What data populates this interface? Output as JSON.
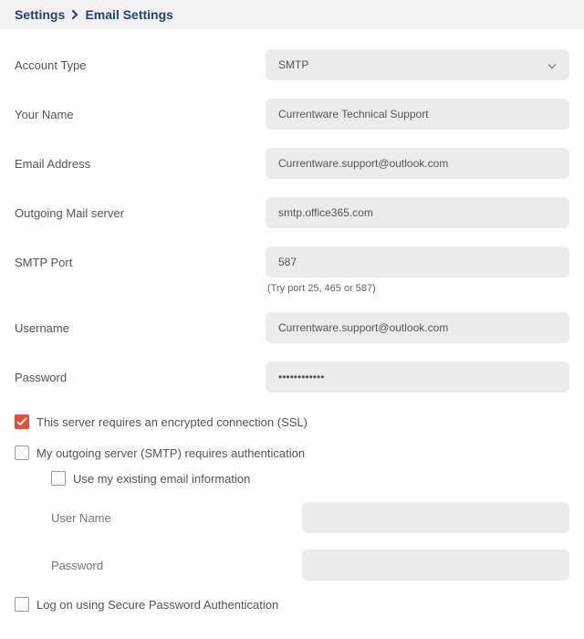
{
  "breadcrumb": {
    "parent": "Settings",
    "current": "Email Settings"
  },
  "labels": {
    "account_type": "Account Type",
    "your_name": "Your Name",
    "email_address": "Email Address",
    "outgoing_mail_server": "Outgoing Mail server",
    "smtp_port": "SMTP Port",
    "smtp_port_hint": "(Try port 25, 465 or 587)",
    "username": "Username",
    "password": "Password",
    "ssl": "This server requires an encrypted connection (SSL)",
    "smtp_auth": "My outgoing server (SMTP) requires authentication",
    "use_existing": "Use my existing email information",
    "sub_username": "User Name",
    "sub_password": "Password",
    "spa": "Log on using Secure Password Authentication"
  },
  "values": {
    "account_type": "SMTP",
    "your_name": "Currentware Technical Support",
    "email_address": "Currentware.support@outlook.com",
    "outgoing_mail_server": "smtp.office365.com",
    "smtp_port": "587",
    "username": "Currentware.support@outlook.com",
    "password": "••••••••••••",
    "sub_username": "",
    "sub_password": ""
  },
  "checked": {
    "ssl": true,
    "smtp_auth": false,
    "use_existing": false,
    "spa": false
  }
}
